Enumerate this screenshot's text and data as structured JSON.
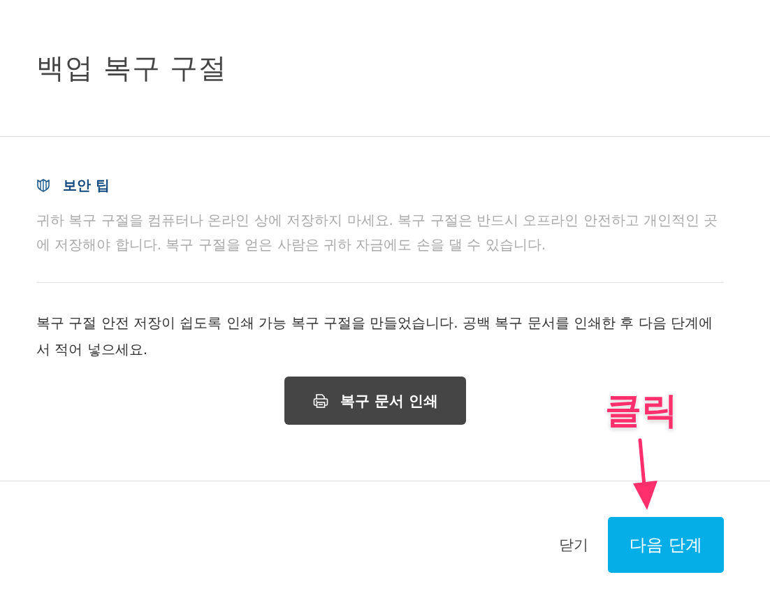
{
  "dialog": {
    "title": "백업 복구 구절"
  },
  "security_tip": {
    "title": "보안 팁",
    "text": "귀하 복구 구절을 컴퓨터나 온라인 상에 저장하지 마세요. 복구 구절은 반드시 오프라인 안전하고 개인적인 곳에 저장해야 합니다. 복구 구절을 얻은 사람은 귀하 자금에도 손을 댈 수 있습니다."
  },
  "description": "복구 구절 안전 저장이 쉽도록 인쇄 가능 복구 구절을 만들었습니다. 공백 복구 문서를 인쇄한 후 다음 단계에서 적어 넣으세요.",
  "print_button": {
    "label": "복구 문서 인쇄"
  },
  "footer_buttons": [
    {
      "label": "닫기",
      "kind": "text"
    },
    {
      "label": "다음 단계",
      "kind": "primary"
    }
  ],
  "annotation": {
    "text": "클릭"
  }
}
